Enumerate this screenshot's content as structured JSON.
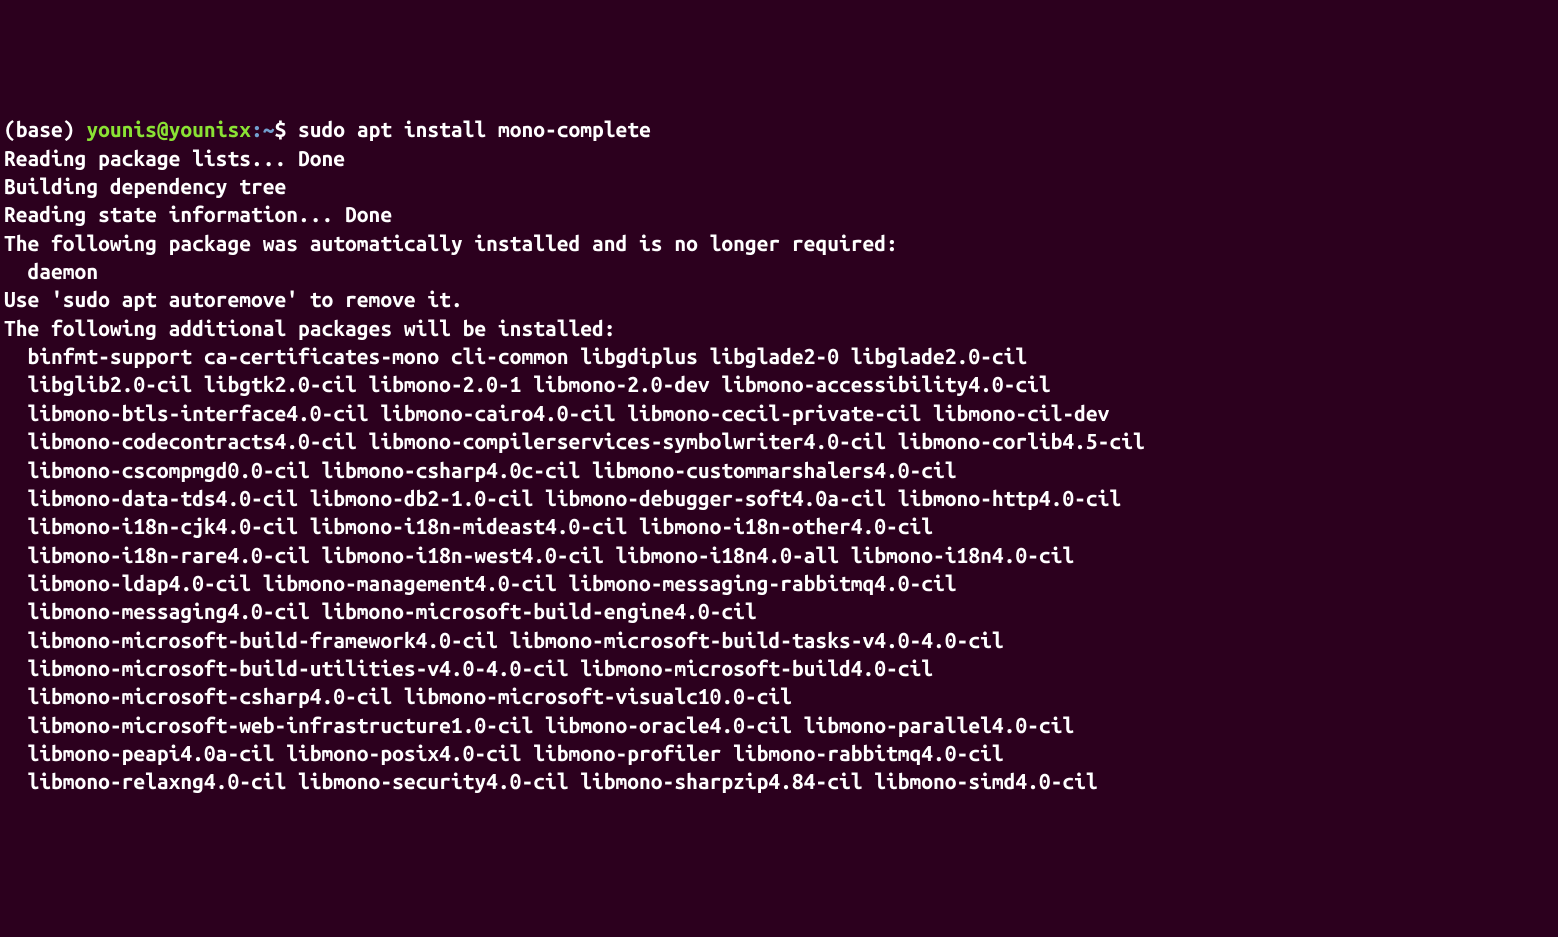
{
  "prompt": {
    "base": "(base) ",
    "user": "younis@younisx",
    "path": ":~",
    "symbol": "$ ",
    "command": "sudo apt install mono-complete"
  },
  "lines": [
    "Reading package lists... Done",
    "Building dependency tree",
    "Reading state information... Done",
    "The following package was automatically installed and is no longer required:",
    "  daemon",
    "Use 'sudo apt autoremove' to remove it.",
    "The following additional packages will be installed:",
    "  binfmt-support ca-certificates-mono cli-common libgdiplus libglade2-0 libglade2.0-cil",
    "  libglib2.0-cil libgtk2.0-cil libmono-2.0-1 libmono-2.0-dev libmono-accessibility4.0-cil",
    "  libmono-btls-interface4.0-cil libmono-cairo4.0-cil libmono-cecil-private-cil libmono-cil-dev",
    "  libmono-codecontracts4.0-cil libmono-compilerservices-symbolwriter4.0-cil libmono-corlib4.5-cil",
    "  libmono-cscompmgd0.0-cil libmono-csharp4.0c-cil libmono-custommarshalers4.0-cil",
    "  libmono-data-tds4.0-cil libmono-db2-1.0-cil libmono-debugger-soft4.0a-cil libmono-http4.0-cil",
    "  libmono-i18n-cjk4.0-cil libmono-i18n-mideast4.0-cil libmono-i18n-other4.0-cil",
    "  libmono-i18n-rare4.0-cil libmono-i18n-west4.0-cil libmono-i18n4.0-all libmono-i18n4.0-cil",
    "  libmono-ldap4.0-cil libmono-management4.0-cil libmono-messaging-rabbitmq4.0-cil",
    "  libmono-messaging4.0-cil libmono-microsoft-build-engine4.0-cil",
    "  libmono-microsoft-build-framework4.0-cil libmono-microsoft-build-tasks-v4.0-4.0-cil",
    "  libmono-microsoft-build-utilities-v4.0-4.0-cil libmono-microsoft-build4.0-cil",
    "  libmono-microsoft-csharp4.0-cil libmono-microsoft-visualc10.0-cil",
    "  libmono-microsoft-web-infrastructure1.0-cil libmono-oracle4.0-cil libmono-parallel4.0-cil",
    "  libmono-peapi4.0a-cil libmono-posix4.0-cil libmono-profiler libmono-rabbitmq4.0-cil",
    "  libmono-relaxng4.0-cil libmono-security4.0-cil libmono-sharpzip4.84-cil libmono-simd4.0-cil"
  ]
}
